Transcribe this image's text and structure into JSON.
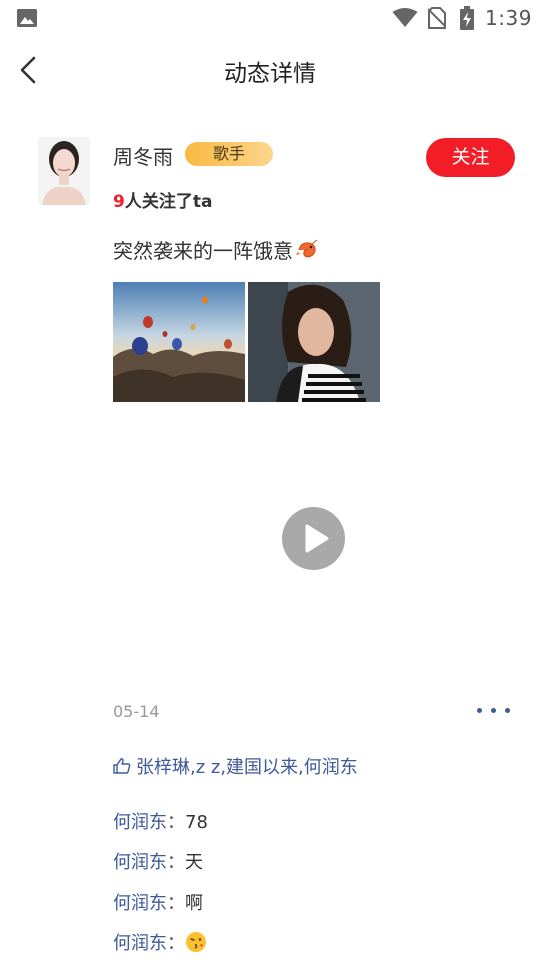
{
  "status_bar": {
    "time": "1:39",
    "icons": [
      "gallery-icon",
      "wifi-icon",
      "no-sim-icon",
      "battery-charging-icon"
    ]
  },
  "header": {
    "title": "动态详情",
    "back_icon": "chevron-left-icon"
  },
  "post": {
    "user_name": "周冬雨",
    "tag": "歌手",
    "follow_label": "关注",
    "followers_count": "9",
    "followers_text": "人关注了ta",
    "text": "突然袭来的一阵饿意",
    "text_emoji": "shrimp-emoji",
    "photos": [
      "hot-air-balloons-photo",
      "woman-portrait-photo"
    ],
    "video_icon": "play-icon",
    "date": "05-14",
    "more_icon": "more-dots-icon",
    "likes": {
      "icon": "thumbs-up-icon",
      "text": "张梓琳,z z,建国以来,何润东"
    },
    "comments": [
      {
        "user": "何润东",
        "sep": "：",
        "text": "78"
      },
      {
        "user": "何润东",
        "sep": "：",
        "text": "天"
      },
      {
        "user": "何润东",
        "sep": "：",
        "text": "啊"
      },
      {
        "user": "何润东",
        "sep": "：",
        "text": "",
        "emoji": "kiss-face-emoji"
      }
    ]
  },
  "colors": {
    "accent_red": "#f31d28",
    "link_blue": "#3d5a99",
    "tag_gold": "#f9b841",
    "play_gray": "#a9a9a9"
  }
}
